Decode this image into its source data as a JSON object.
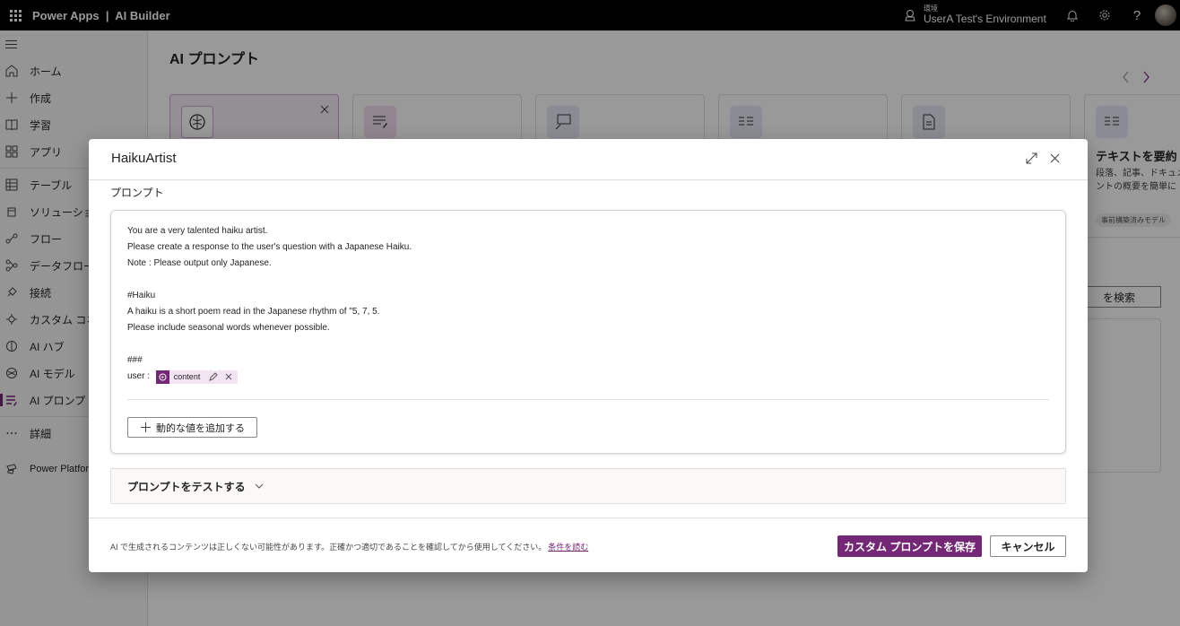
{
  "topbar": {
    "app_title": "Power Apps  |  AI Builder",
    "env_label": "環境",
    "env_name": "UserA Test's Environment"
  },
  "nav": {
    "items": [
      {
        "label": "ホーム",
        "icon": "home-icon"
      },
      {
        "label": "作成",
        "icon": "plus-icon"
      },
      {
        "label": "学習",
        "icon": "book-icon"
      },
      {
        "label": "アプリ",
        "icon": "apps-icon"
      },
      {
        "label": "テーブル",
        "icon": "table-icon"
      },
      {
        "label": "ソリューション",
        "icon": "solution-icon"
      },
      {
        "label": "フロー",
        "icon": "flow-icon"
      },
      {
        "label": "データフロー",
        "icon": "dataflow-icon"
      },
      {
        "label": "接続",
        "icon": "plug-icon"
      },
      {
        "label": "カスタム コネ",
        "icon": "connector-icon"
      },
      {
        "label": "AI ハブ",
        "icon": "ai-hub-icon"
      },
      {
        "label": "AI モデル",
        "icon": "brain-icon"
      },
      {
        "label": "AI プロンプト",
        "icon": "prompt-icon"
      },
      {
        "label": "詳細",
        "icon": "more-icon"
      }
    ],
    "platform_label": "Power Platform"
  },
  "page": {
    "title": "AI プロンプト",
    "cards": [
      {
        "title": "",
        "desc": "",
        "badge": ""
      },
      {
        "title": "",
        "desc": "",
        "badge": ""
      },
      {
        "title": "",
        "desc": "",
        "badge": ""
      },
      {
        "title": "",
        "desc": "",
        "badge": ""
      },
      {
        "title": "",
        "desc": "",
        "badge": ""
      },
      {
        "title": "テキストを要約",
        "desc": "段落、記事、ドキュメントの概要を簡単に",
        "badge": "事前構築済みモデル"
      }
    ],
    "search_label": "を検索"
  },
  "dialog": {
    "title": "HaikuArtist",
    "section_label": "プロンプト",
    "prompt_lines": [
      "You are a very talented haiku artist.",
      "Please create a response to the user's question with a Japanese Haiku.",
      "Note : Please output only Japanese.",
      "",
      "#Haiku",
      "A haiku is a short poem read in the Japanese rhythm of \"5, 7, 5.",
      "Please include seasonal words whenever possible.",
      "",
      "###"
    ],
    "user_prefix": "user : ",
    "token_name": "content",
    "add_dynamic_label": "動的な値を追加する",
    "test_label": "プロンプトをテストする",
    "disclaimer": "AI で生成されるコンテンツは正しくない可能性があります。正確かつ適切であることを確認してから使用してください。",
    "terms_link": "条件を読む",
    "save_label": "カスタム プロンプトを保存",
    "cancel_label": "キャンセル"
  },
  "colors": {
    "accent": "#742774",
    "topbar": "#000000"
  }
}
